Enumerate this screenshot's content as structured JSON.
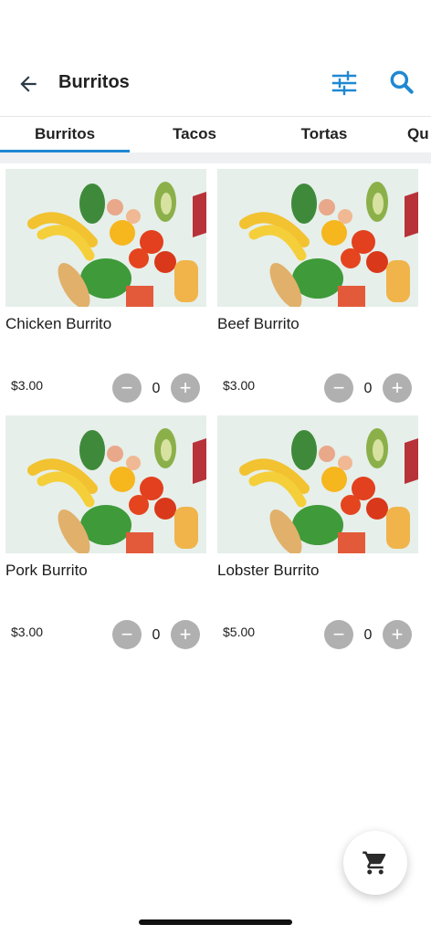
{
  "header": {
    "title": "Burritos",
    "back_icon": "arrow-left-icon",
    "filter_icon": "tune-sliders-icon",
    "search_icon": "search-icon"
  },
  "tabs": [
    {
      "label": "Burritos",
      "active": true
    },
    {
      "label": "Tacos",
      "active": false
    },
    {
      "label": "Tortas",
      "active": false
    },
    {
      "label": "Qu",
      "active": false
    }
  ],
  "products": [
    {
      "name": "Chicken Burrito",
      "price": "$3.00",
      "quantity": "0"
    },
    {
      "name": "Beef Burrito",
      "price": "$3.00",
      "quantity": "0"
    },
    {
      "name": "Pork Burrito",
      "price": "$3.00",
      "quantity": "0"
    },
    {
      "name": "Lobster Burrito",
      "price": "$5.00",
      "quantity": "0"
    }
  ],
  "stepper": {
    "minus": "−",
    "plus": "+"
  },
  "cart_icon": "shopping-cart-icon",
  "colors": {
    "accent": "#1e88d2",
    "stepper": "#b0b0b0"
  }
}
